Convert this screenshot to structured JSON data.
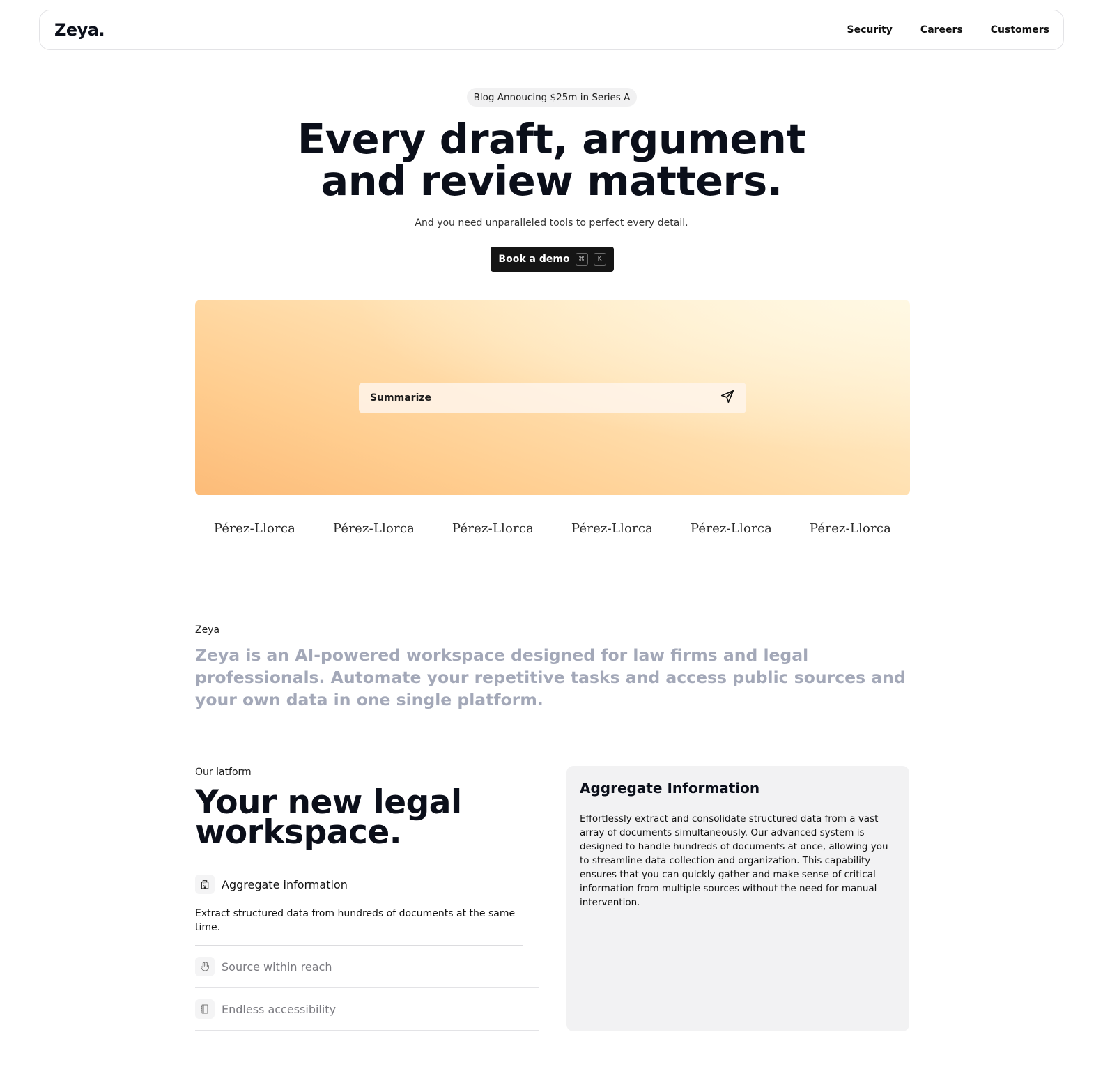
{
  "nav": {
    "logo": "Zeya.",
    "links": [
      "Security",
      "Careers",
      "Customers"
    ]
  },
  "hero": {
    "announcement": "Blog Annoucing $25m in Series A",
    "title_line1": "Every draft, argument",
    "title_line2": "and review matters.",
    "subtitle": "And you need unparalleled tools to perfect every detail.",
    "cta_label": "Book a demo",
    "shortcut_keys": [
      "⌘",
      "K"
    ]
  },
  "prompt": {
    "text": "Summarize",
    "send_icon": "send-icon"
  },
  "clients": [
    "Pérez-Llorca",
    "Pérez-Llorca",
    "Pérez-Llorca",
    "Pérez-Llorca",
    "Pérez-Llorca",
    "Pérez-Llorca"
  ],
  "about": {
    "label": "Zeya",
    "text": "Zeya is an AI-powered workspace designed for law firms and legal professionals. Automate your repetitive tasks and access public sources and your own data in one single platform."
  },
  "platform": {
    "label": "Our latform",
    "title": "Your new legal workspace.",
    "features": [
      {
        "title": "Aggregate information",
        "desc": "Extract structured data from hundreds of documents at the same time.",
        "icon": "building-icon",
        "active": true
      },
      {
        "title": "Source within reach",
        "icon": "hand-icon",
        "active": false
      },
      {
        "title": "Endless accessibility",
        "icon": "book-icon",
        "active": false
      }
    ]
  },
  "panel": {
    "title": "Aggregate Information",
    "text": "Effortlessly extract and consolidate structured data from a vast array of documents simultaneously. Our advanced system is designed to handle hundreds of documents at once, allowing you to streamline data collection and organization. This capability ensures that you can quickly gather and make sense of critical information from multiple sources without the need for manual intervention."
  },
  "colors": {
    "accent_dark": "#151515",
    "gradient_light": "#fff2d4",
    "gradient_dark": "#fcbb78",
    "muted_text": "#a3a8b8"
  }
}
